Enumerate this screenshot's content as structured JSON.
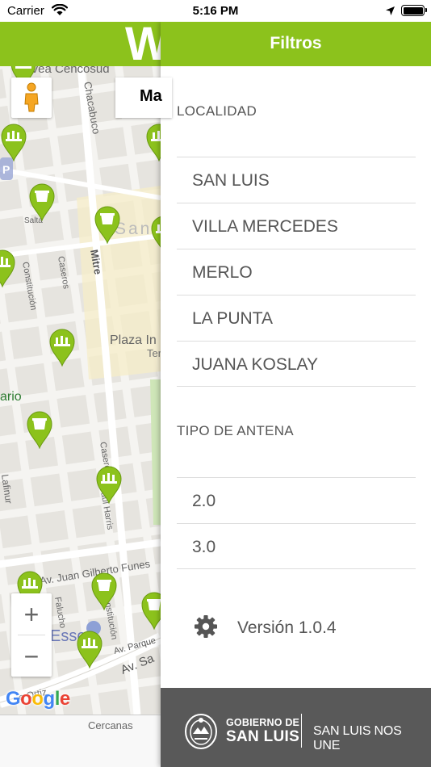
{
  "status_bar": {
    "carrier": "Carrier",
    "time": "5:16 PM"
  },
  "header": {
    "logo_letter": "W",
    "drawer_title": "Filtros"
  },
  "map": {
    "map_type_button": "Ma",
    "street_labels": [
      "Vea Cencosud",
      "Chacabuco",
      "Constitución",
      "Caseros",
      "Mitre",
      "Salta",
      "San",
      "Plaza In",
      "Ter",
      "ario",
      "Caseros",
      "Paul Harris",
      "Lafinur",
      "Av. Juan Gilberto Funes",
      "Falucho",
      "Constitución",
      "Esso",
      "Av. Parque",
      "Av. Sa",
      "e Ortiz"
    ],
    "google_logo": "Google",
    "zoom_in_label": "+",
    "zoom_out_label": "−",
    "marker_color": "#8cc21c"
  },
  "tabbar": {
    "tab_label": "Cercanas"
  },
  "filters": {
    "localidad_title": "LOCALIDAD",
    "localidades": [
      "SAN LUIS",
      "VILLA MERCEDES",
      "MERLO",
      "LA PUNTA",
      "JUANA KOSLAY"
    ],
    "antena_title": "TIPO DE ANTENA",
    "antenas": [
      "2.0",
      "3.0"
    ],
    "version_text": "Versión 1.0.4"
  },
  "footer": {
    "gob_label": "GOBIERNO DE",
    "gob_name": "SAN LUIS",
    "slogan": "SAN LUIS NOS UNE"
  },
  "colors": {
    "brand_green": "#8cc21c",
    "footer_gray": "#595959",
    "text_gray": "#555555"
  }
}
